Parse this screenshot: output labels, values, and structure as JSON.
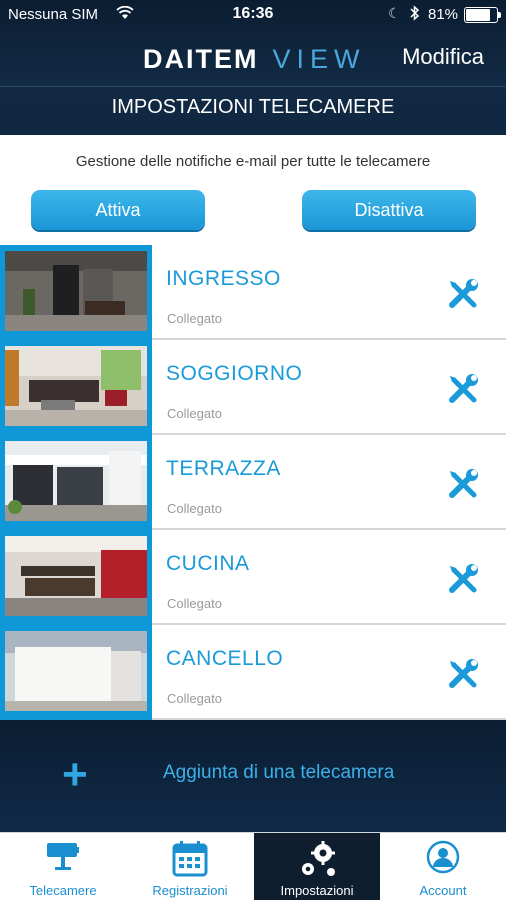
{
  "status_bar": {
    "carrier": "Nessuna SIM",
    "time": "16:36",
    "battery": "81%",
    "battery_level": 0.81
  },
  "header": {
    "brand_primary": "DAITEM",
    "brand_secondary": "VIEW",
    "edit_label": "Modifica",
    "section_title": "IMPOSTAZIONI TELECAMERE"
  },
  "notifications": {
    "description": "Gestione delle notifiche e-mail per tutte le telecamere",
    "enable_label": "Attiva",
    "disable_label": "Disattiva"
  },
  "cameras": [
    {
      "name": "INGRESSO",
      "status": "Collegato"
    },
    {
      "name": "SOGGIORNO",
      "status": "Collegato"
    },
    {
      "name": "TERRAZZA",
      "status": "Collegato"
    },
    {
      "name": "CUCINA",
      "status": "Collegato"
    },
    {
      "name": "CANCELLO",
      "status": "Collegato"
    }
  ],
  "add_camera": {
    "label": "Aggiunta di una telecamera"
  },
  "tabs": [
    {
      "label": "Telecamere",
      "icon": "camera-icon",
      "active": false
    },
    {
      "label": "Registrazioni",
      "icon": "calendar-icon",
      "active": false
    },
    {
      "label": "Impostazioni",
      "icon": "gears-icon",
      "active": true
    },
    {
      "label": "Account",
      "icon": "account-icon",
      "active": false
    }
  ],
  "colors": {
    "accent": "#1a9ad8",
    "header_bg": "#0e2236"
  }
}
